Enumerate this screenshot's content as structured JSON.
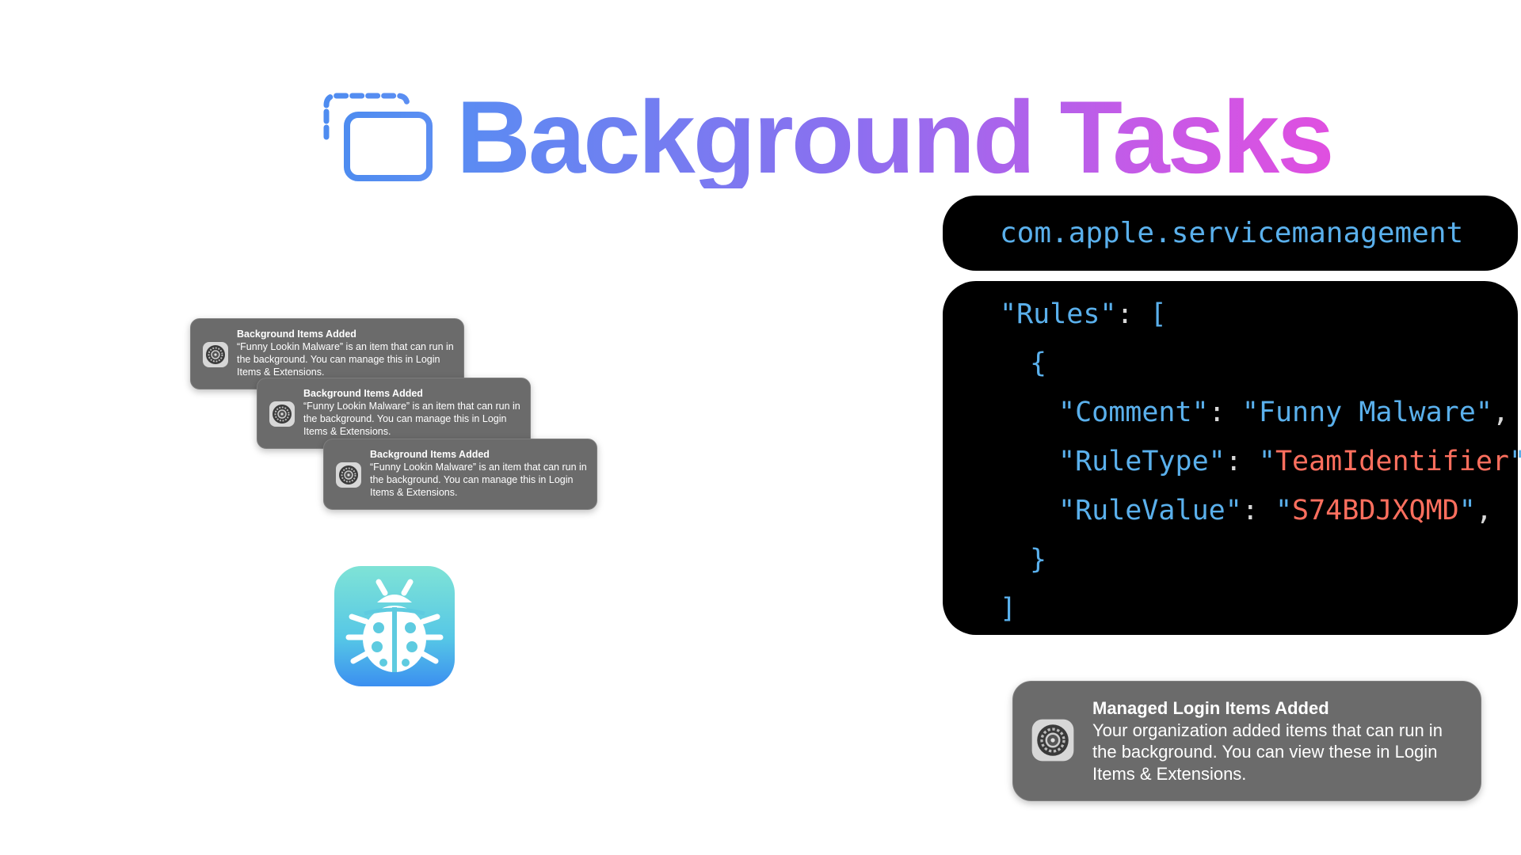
{
  "title": {
    "text": "Background Tasks",
    "icon": "stacked-windows-icon"
  },
  "domain_panel": {
    "text": "com.apple.servicemanagement"
  },
  "rules_panel": {
    "rules_key": "\"Rules\"",
    "colon": ": ",
    "open_bracket": "[",
    "open_brace": "{",
    "comment_key": "\"Comment\"",
    "comment_value": "\"Funny Malware\"",
    "ruletype_key": "\"RuleType\"",
    "ruletype_q1": "\"",
    "ruletype_value": "TeamIdentifier",
    "ruletype_q2": "\"",
    "rulevalue_key": "\"RuleValue\"",
    "rulevalue_q1": "\"",
    "rulevalue_value": "S74BDJXQMD",
    "rulevalue_q2": "\"",
    "comma": ",",
    "close_brace": "}",
    "close_bracket": "]"
  },
  "small_notifications": [
    {
      "title": "Background Items Added",
      "body": "“Funny Lookin Malware” is an item that can run in the background. You can manage this in Login Items & Extensions.",
      "icon": "system-settings-gear-icon"
    },
    {
      "title": "Background Items Added",
      "body": "“Funny Lookin Malware” is an item that can run in the background. You can manage this in Login Items & Extensions.",
      "icon": "system-settings-gear-icon"
    },
    {
      "title": "Background Items Added",
      "body": "“Funny Lookin Malware” is an item that can run in the background. You can manage this in Login Items & Extensions.",
      "icon": "system-settings-gear-icon"
    }
  ],
  "managed_notification": {
    "title": "Managed Login Items Added",
    "body": "Your organization added items that can run in the background. You can view these in Login Items & Extensions.",
    "icon": "system-settings-gear-icon"
  },
  "app_icon": {
    "icon": "ladybug-icon"
  },
  "colors": {
    "key_blue": "#5ab0ec",
    "value_red": "#ff6f5e",
    "gradient_start": "#5a8cf2",
    "gradient_end": "#e04fe0",
    "notification_bg": "#6b6b6b"
  }
}
